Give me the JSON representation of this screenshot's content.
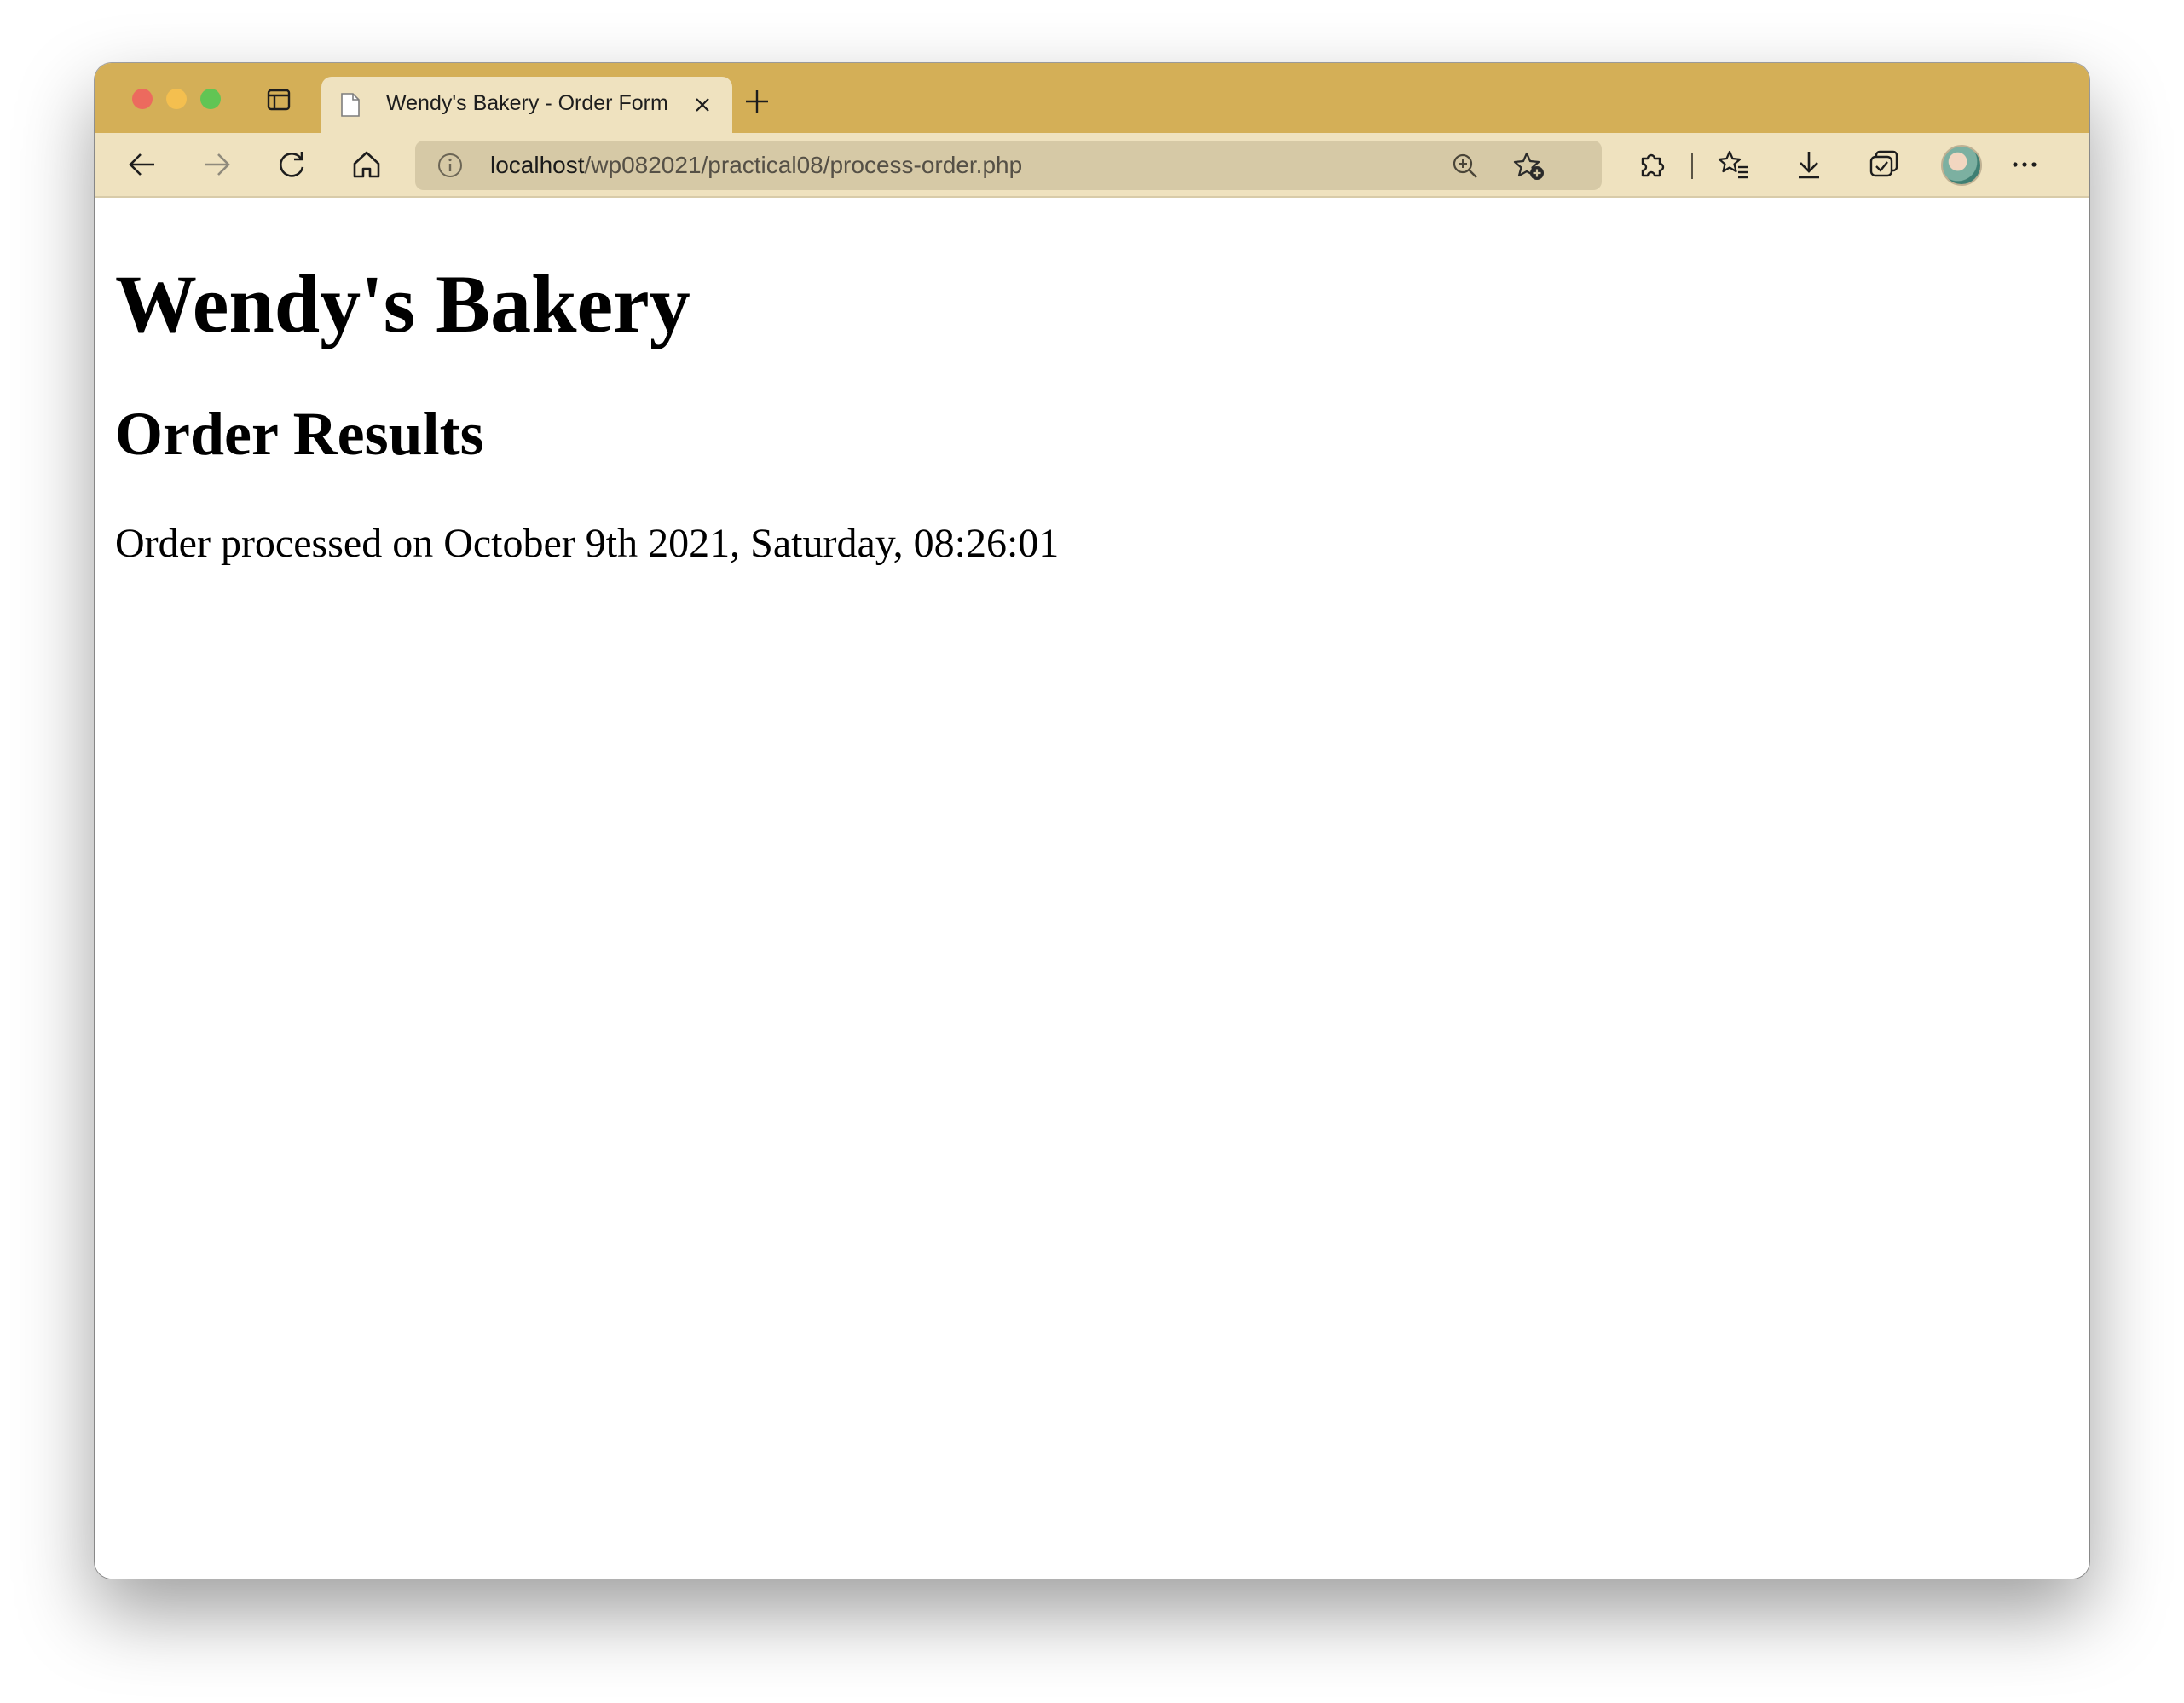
{
  "browser": {
    "tab": {
      "title": "Wendy's Bakery - Order Form"
    },
    "address": {
      "host": "localhost",
      "path": "/wp082021/practical08/process-order.php"
    },
    "theme": {
      "tabstrip": "#d4af57",
      "toolbar": "#efe2bf",
      "addressbar": "#d6c9a6"
    },
    "icons": {
      "back": "arrow-left-icon",
      "forward": "arrow-right-icon",
      "reload": "reload-icon",
      "home": "home-icon",
      "info": "info-icon",
      "zoom": "zoom-in-icon",
      "favorite": "add-favorite-icon",
      "extensions": "puzzle-icon",
      "favorites": "favorites-list-icon",
      "downloads": "download-icon",
      "collections": "collections-icon",
      "more": "more-icon"
    }
  },
  "page": {
    "heading": "Wendy's Bakery",
    "subheading": "Order Results",
    "message": "Order processed on October 9th 2021, Saturday, 08:26:01"
  }
}
